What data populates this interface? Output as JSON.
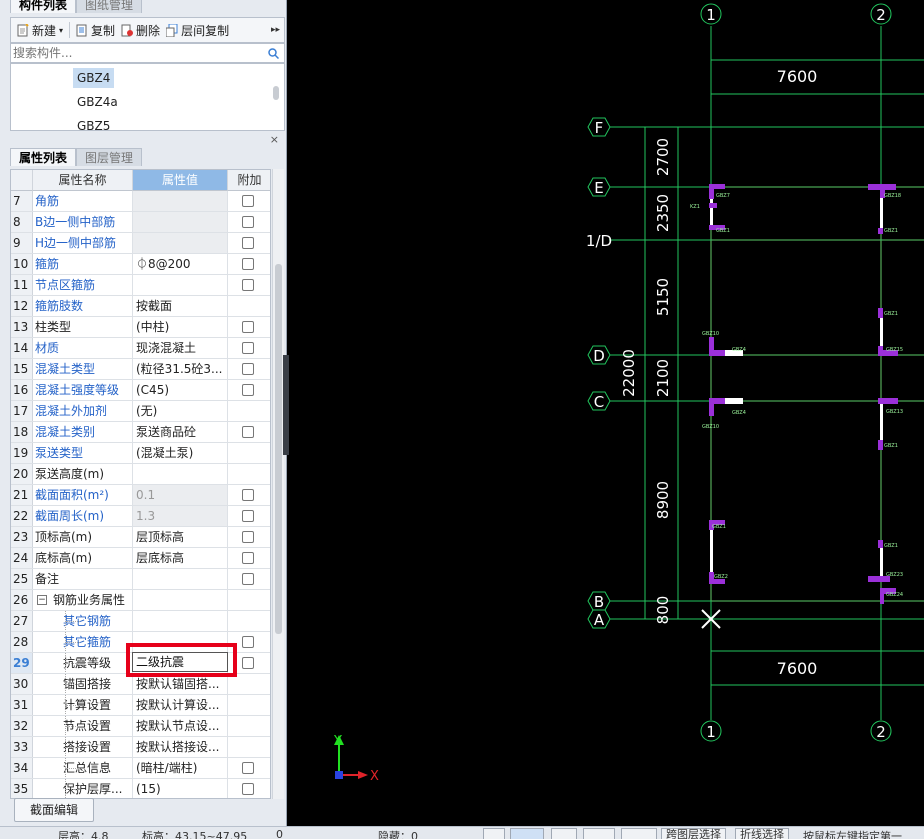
{
  "left_tabs_top": [
    "构件列表",
    "图纸管理"
  ],
  "toolbar": {
    "new": "新建",
    "copy": "复制",
    "delete": "删除",
    "floor_copy": "层间复制",
    "more": "▸▸"
  },
  "search": {
    "placeholder": "搜索构件..."
  },
  "components": [
    "GBZ4",
    "GBZ4a",
    "GBZ5"
  ],
  "left_tabs_mid": [
    "属性列表",
    "图层管理"
  ],
  "prop_headers": {
    "name": "属性名称",
    "value": "属性值",
    "extra": "附加"
  },
  "props": [
    {
      "n": "7",
      "name": "角筋",
      "value": "",
      "style": "blue",
      "grey": true,
      "chk": true
    },
    {
      "n": "8",
      "name": "B边一侧中部筋",
      "value": "",
      "style": "blue",
      "grey": true,
      "chk": true
    },
    {
      "n": "9",
      "name": "H边一侧中部筋",
      "value": "",
      "style": "blue",
      "grey": true,
      "chk": true
    },
    {
      "n": "10",
      "name": "箍筋",
      "value": "⏀8@200",
      "style": "blue",
      "chk": true
    },
    {
      "n": "11",
      "name": "节点区箍筋",
      "value": "",
      "style": "blue",
      "chk": true
    },
    {
      "n": "12",
      "name": "箍筋肢数",
      "value": "按截面",
      "style": "blue",
      "chk": false
    },
    {
      "n": "13",
      "name": "柱类型",
      "value": "(中柱)",
      "style": "black",
      "chk": true
    },
    {
      "n": "14",
      "name": "材质",
      "value": "现浇混凝土",
      "style": "blue",
      "chk": true
    },
    {
      "n": "15",
      "name": "混凝土类型",
      "value": "(粒径31.5砼3...",
      "style": "blue",
      "chk": true
    },
    {
      "n": "16",
      "name": "混凝土强度等级",
      "value": "(C45)",
      "style": "blue",
      "chk": true
    },
    {
      "n": "17",
      "name": "混凝土外加剂",
      "value": "(无)",
      "style": "blue",
      "chk": false
    },
    {
      "n": "18",
      "name": "混凝土类别",
      "value": "泵送商品砼",
      "style": "blue",
      "chk": true
    },
    {
      "n": "19",
      "name": "泵送类型",
      "value": "(混凝土泵)",
      "style": "blue",
      "chk": false
    },
    {
      "n": "20",
      "name": "泵送高度(m)",
      "value": "",
      "style": "black",
      "chk": false
    },
    {
      "n": "21",
      "name": "截面面积(m²)",
      "value": "0.1",
      "style": "blue",
      "grey": true,
      "dim": true,
      "chk": true
    },
    {
      "n": "22",
      "name": "截面周长(m)",
      "value": "1.3",
      "style": "blue",
      "grey": true,
      "dim": true,
      "chk": true
    },
    {
      "n": "23",
      "name": "顶标高(m)",
      "value": "层顶标高",
      "style": "black",
      "chk": true
    },
    {
      "n": "24",
      "name": "底标高(m)",
      "value": "层底标高",
      "style": "black",
      "chk": true
    },
    {
      "n": "25",
      "name": "备注",
      "value": "",
      "style": "black",
      "chk": true
    },
    {
      "n": "26",
      "name": "钢筋业务属性",
      "value": "",
      "style": "group",
      "chk": false
    },
    {
      "n": "27",
      "name": "其它钢筋",
      "value": "",
      "style": "subblue",
      "chk": false
    },
    {
      "n": "28",
      "name": "其它箍筋",
      "value": "",
      "style": "subblue",
      "chk": true
    },
    {
      "n": "29",
      "name": "抗震等级",
      "value": "二级抗震",
      "style": "sub",
      "chk": true,
      "current": true
    },
    {
      "n": "30",
      "name": "锚固搭接",
      "value": "按默认锚固搭...",
      "style": "sub",
      "chk": false
    },
    {
      "n": "31",
      "name": "计算设置",
      "value": "按默认计算设...",
      "style": "sub",
      "chk": false
    },
    {
      "n": "32",
      "name": "节点设置",
      "value": "按默认节点设...",
      "style": "sub",
      "chk": false
    },
    {
      "n": "33",
      "name": "搭接设置",
      "value": "按默认搭接设...",
      "style": "sub",
      "chk": false
    },
    {
      "n": "34",
      "name": "汇总信息",
      "value": "(暗柱/端柱)",
      "style": "sub",
      "chk": true
    },
    {
      "n": "35",
      "name": "保护层厚...",
      "value": "(15)",
      "style": "sub",
      "chk": true
    }
  ],
  "section_edit": "截面编辑",
  "status": {
    "floor": "层高：4.8",
    "elev": "标高：43.15~47.95",
    "val": "0",
    "hidden": "隐藏：0",
    "b1": "跨图层选择",
    "b2": "折线选择",
    "b3": "按鼠标左键指定第一"
  },
  "cad": {
    "axes_cols": [
      "1",
      "2"
    ],
    "axes_rows": [
      "F",
      "E",
      "1/D",
      "D",
      "C",
      "B",
      "A"
    ],
    "dim_top": "7600",
    "dim_bottom": "7600",
    "dims_vertical": [
      "2700",
      "2350",
      "5150",
      "2100",
      "8900",
      "800"
    ],
    "dim_total": "22000",
    "labels_small": [
      "GBZ7",
      "KZ1",
      "GBZ1",
      "GBZ18",
      "GBZ1",
      "GBZ1",
      "GBZ15",
      "GBZ10",
      "GBZ4",
      "GBZ10",
      "GBZ4",
      "GBZ13",
      "GBZ1",
      "GBZ1",
      "GBZ2",
      "GBZ1",
      "GBZ23",
      "GBZ24"
    ],
    "ucs_y": "Y",
    "ucs_x": "X",
    "colors": {
      "axis": "#22c55e",
      "beam": "#e01a2a",
      "column": "#9b30d9",
      "wall": "#ffffff"
    }
  }
}
